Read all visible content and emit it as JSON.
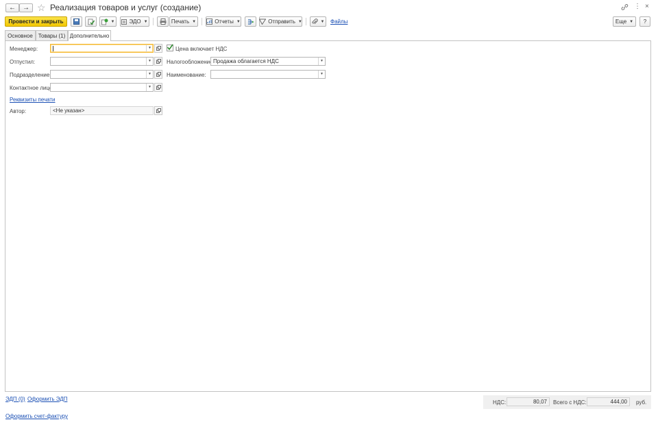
{
  "window": {
    "title": "Реализация товаров и услуг (создание)",
    "favorite_icon": "star-outline-icon"
  },
  "toolbar": {
    "post_and_close": "Провести и закрыть",
    "edo": "ЭДО",
    "print": "Печать",
    "reports": "Отчеты",
    "send": "Отправить",
    "files": "Файлы",
    "more": "Еще",
    "help": "?"
  },
  "tabs": [
    {
      "label": "Основное"
    },
    {
      "label": "Товары (1)"
    },
    {
      "label": "Дополнительно"
    }
  ],
  "form": {
    "manager_label": "Менеджер:",
    "manager_value": "",
    "released_label": "Отпустил:",
    "released_value": "",
    "department_label": "Подразделение:",
    "department_value": "",
    "contact_label": "Контактное лицо:",
    "contact_value": "",
    "print_details_link": "Реквизиты печати",
    "author_label": "Автор:",
    "author_value": "<Не указан>",
    "vat_included_label": "Цена включает НДС",
    "vat_included_checked": true,
    "taxation_label": "Налогообложение:",
    "taxation_value": "Продажа облагается НДС",
    "name_label": "Наименование:",
    "name_value": ""
  },
  "footer": {
    "edo_link": "ЭДП (0)",
    "make_edo_link": "Оформить ЭДП",
    "invoice_link": "Оформить счет-фактуру",
    "vat_label": "НДС:",
    "vat_value": "80,07",
    "total_label": "Всего с НДС:",
    "total_value": "444,00",
    "currency": "руб."
  },
  "colors": {
    "primary_button": "#f2c700",
    "link": "#1a4fb4",
    "focus_border": "#f5b830",
    "checkbox_check": "#2e8b2e"
  }
}
